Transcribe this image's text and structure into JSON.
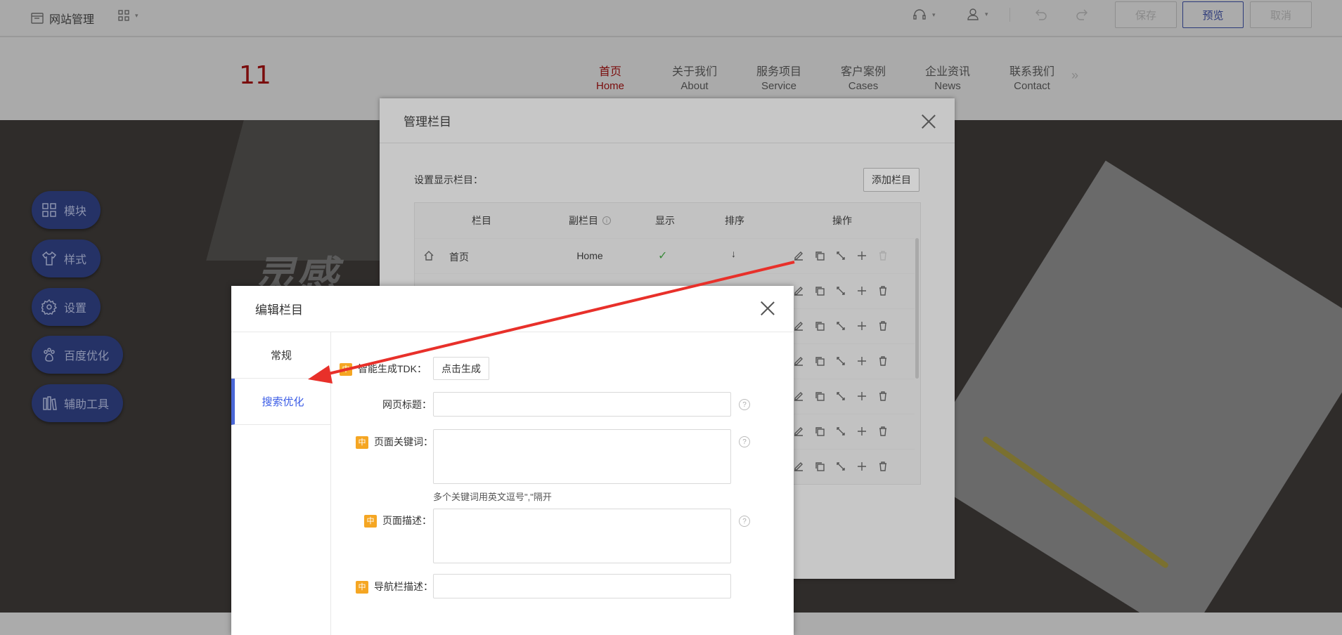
{
  "topbar": {
    "site_manage": "网站管理",
    "save": "保存",
    "preview": "预览",
    "cancel": "取消"
  },
  "site": {
    "logo": "11",
    "nav": [
      {
        "zh": "首页",
        "en": "Home"
      },
      {
        "zh": "关于我们",
        "en": "About"
      },
      {
        "zh": "服务项目",
        "en": "Service"
      },
      {
        "zh": "客户案例",
        "en": "Cases"
      },
      {
        "zh": "企业资讯",
        "en": "News"
      },
      {
        "zh": "联系我们",
        "en": "Contact"
      }
    ],
    "banner_text": "灵感"
  },
  "float_menu": [
    {
      "label": "模块",
      "icon": "grid-icon"
    },
    {
      "label": "样式",
      "icon": "shirt-icon"
    },
    {
      "label": "设置",
      "icon": "gear-icon"
    },
    {
      "label": "百度优化",
      "icon": "paw-icon"
    },
    {
      "label": "辅助工具",
      "icon": "tools-icon"
    }
  ],
  "manage_modal": {
    "title": "管理栏目",
    "set_label": "设置显示栏目：",
    "add_button": "添加栏目",
    "columns": {
      "name": "栏目",
      "sub": "副栏目",
      "show": "显示",
      "sort": "排序",
      "ops": "操作"
    },
    "first_row": {
      "name": "首页",
      "sub": "Home",
      "sort": "↓"
    }
  },
  "edit_modal": {
    "title": "编辑栏目",
    "tabs": [
      "常规",
      "搜索优化"
    ],
    "active_tab": "搜索优化",
    "fields": {
      "tdk_label": "智能生成TDK：",
      "tdk_button": "点击生成",
      "title_label": "网页标题：",
      "keywords_label": "页面关键词：",
      "keywords_hint": "多个关键词用英文逗号\",\"隔开",
      "desc_label": "页面描述：",
      "navdesc_label": "导航栏描述：",
      "zh_badge": "中"
    }
  },
  "colors": {
    "accent_blue": "#3b5ce6",
    "badge_orange": "#f5a623",
    "arrow_red": "#e8302a",
    "logo_red": "#7a0c0c"
  }
}
